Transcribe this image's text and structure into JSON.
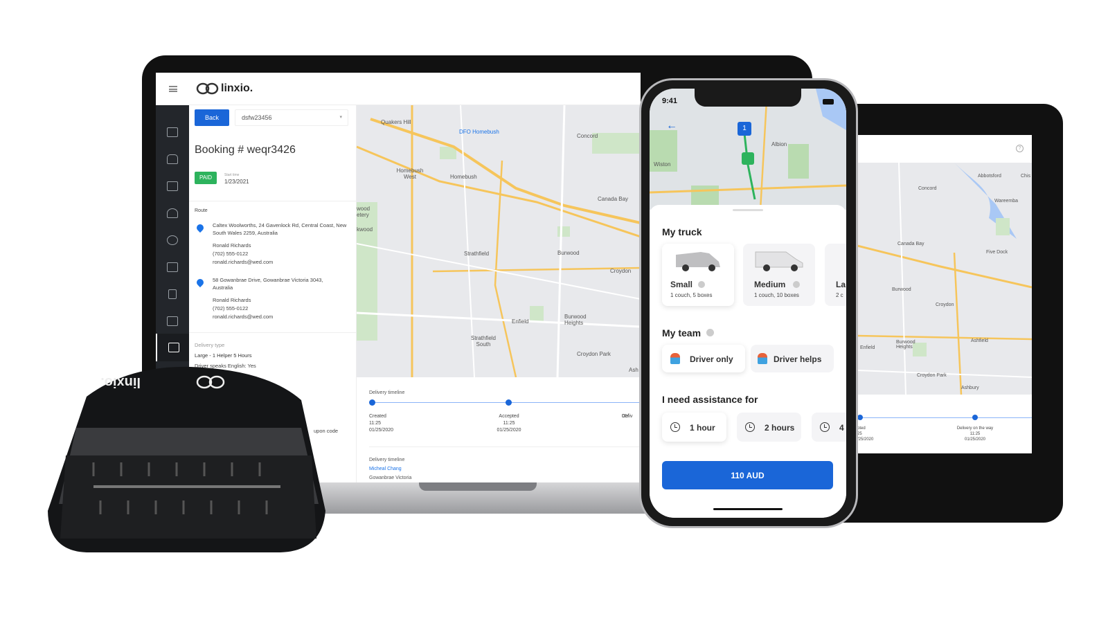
{
  "laptop": {
    "logo": "linxio.",
    "toolbar": {
      "back_label": "Back",
      "vehicle_select": "dsfw23456"
    },
    "booking": {
      "title": "Booking # weqr3426",
      "status": "PAID",
      "start_time_label": "Start time",
      "start_time": "1/23/2021",
      "route_label": "Route",
      "stops": [
        {
          "address": "Caltex Woolworths, 24 Gavenlock Rd, Central Coast, New South Wales 2259, Australia",
          "name": "Ronald Richards",
          "phone": "(702) 555-0122",
          "email": "ronald.richards@wed.com"
        },
        {
          "address": "58 Gowanbrae Drive, Gowanbrae Victoria 3043, Australia",
          "name": "Ronald Richards",
          "phone": "(702) 555-0122",
          "email": "ronald.richards@wed.com"
        }
      ],
      "delivery_type_label": "Delivery type",
      "delivery_type": "Large - 1 Helper  5 Hours",
      "driver_english": "Driver speaks English: Yes",
      "coupon_label": "upon code"
    },
    "map_labels": [
      "Quakers Hill",
      "DFO Homebush",
      "Concord",
      "Homebush West",
      "Homebush",
      "Canada Bay",
      "Strathfield",
      "Burwood",
      "Croydon",
      "Enfield",
      "Burwood Heights",
      "Strathfield South",
      "Croydon Park",
      "wood etery",
      "kwood",
      "Ash"
    ],
    "timeline": {
      "title": "Delivery timeline",
      "steps": [
        {
          "label": "Created",
          "time": "11:25",
          "date": "01/25/2020"
        },
        {
          "label": "Accepted",
          "time": "11:25",
          "date": "01/25/2020"
        },
        {
          "label": "Deliv",
          "time": "",
          "date": "01/"
        }
      ],
      "second_title": "Delivery timeline",
      "driver": "Micheal Chang",
      "location": "Gowanbrae Victoria"
    }
  },
  "tablet": {
    "map_labels": [
      "Abbotsford",
      "Chis",
      "Concord",
      "Wareemba",
      "Canada Bay",
      "Five Dock",
      "Burwood",
      "Croydon",
      "Enfield",
      "Ashfield",
      "Burwood Heights",
      "Croydon Park",
      "Ashbury"
    ],
    "timeline": [
      {
        "label": "pted",
        "time": "25",
        "date": "/25/2020"
      },
      {
        "label": "Delivery on the way",
        "time": "11:25",
        "date": "01/25/2020"
      }
    ]
  },
  "phone": {
    "status_time": "9:41",
    "map_marker": "1",
    "map_labels": [
      "Wiston",
      "Albion"
    ],
    "truck_title": "My truck",
    "trucks": [
      {
        "name": "Small",
        "desc": "1 couch, 5 boxes",
        "selected": true
      },
      {
        "name": "Medium",
        "desc": "1 couch, 10 boxes",
        "selected": false
      },
      {
        "name": "La",
        "desc": "2 c",
        "selected": false
      }
    ],
    "team_title": "My team",
    "team": [
      {
        "label": "Driver only",
        "selected": true
      },
      {
        "label": "Driver helps",
        "selected": false
      }
    ],
    "assist_title": "I need assistance for",
    "assist": [
      {
        "label": "1 hour",
        "selected": true
      },
      {
        "label": "2 hours",
        "selected": false
      },
      {
        "label": "4",
        "selected": false
      }
    ],
    "price_button": "110 AUD"
  },
  "device": {
    "logo": "linxio."
  },
  "colors": {
    "primary": "#1a66d8",
    "paid": "#2db35d",
    "sidebar": "#23262b"
  }
}
